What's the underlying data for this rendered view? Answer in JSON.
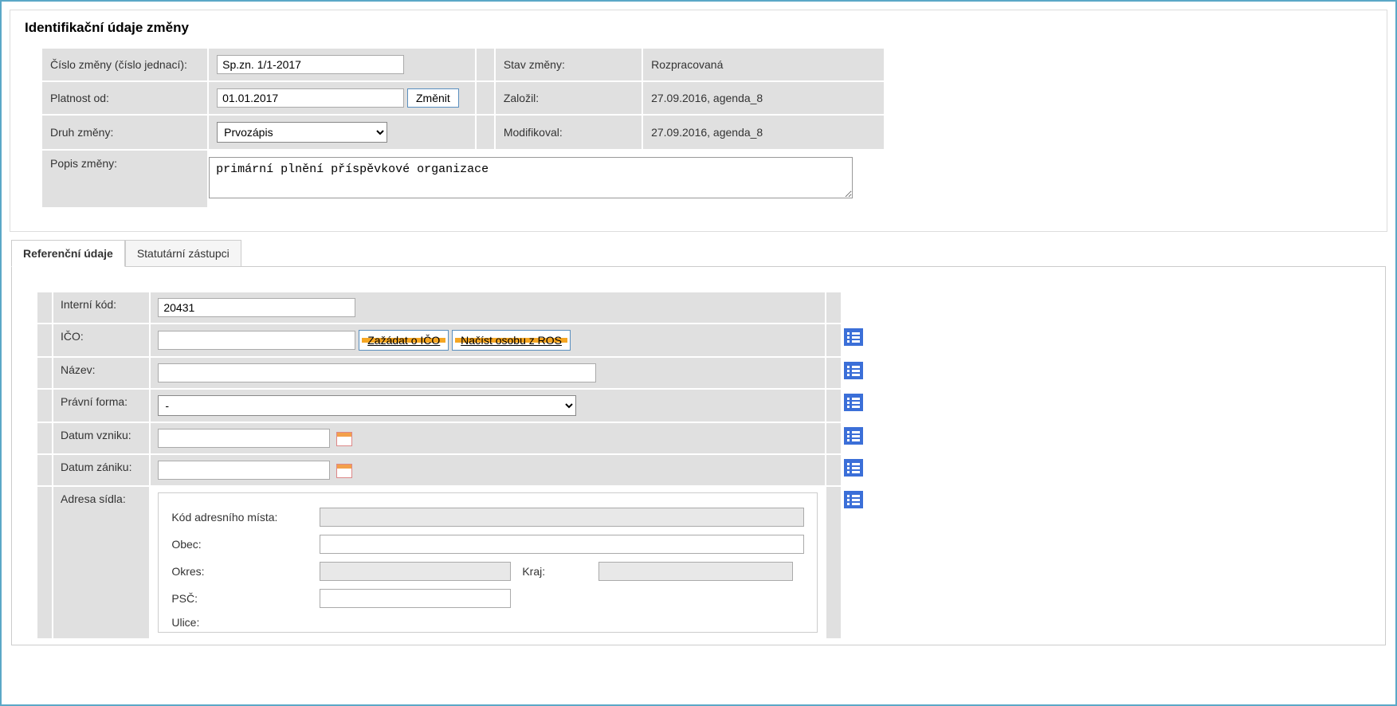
{
  "ident": {
    "title": "Identifikační údaje změny",
    "cislo_zmeny_label": "Číslo změny (číslo jednací):",
    "cislo_zmeny_value": "Sp.zn. 1/1-2017",
    "platnost_od_label": "Platnost od:",
    "platnost_od_value": "01.01.2017",
    "zmenit_btn": "Změnit",
    "druh_label": "Druh změny:",
    "druh_value": "Prvozápis",
    "popis_label": "Popis změny:",
    "popis_value": "primární plnění příspěvkové organizace",
    "stav_label": "Stav změny:",
    "stav_value": "Rozpracovaná",
    "zalozil_label": "Založil:",
    "zalozil_value": "27.09.2016, agenda_8",
    "modifikoval_label": "Modifikoval:",
    "modifikoval_value": "27.09.2016, agenda_8"
  },
  "tabs": {
    "ref": "Referenční údaje",
    "stat": "Statutární zástupci"
  },
  "ref": {
    "interni_kod_label": "Interní kód:",
    "interni_kod_value": "20431",
    "ico_label": "IČO:",
    "ico_value": "",
    "btn_zazadat": "Zažádat o IČO",
    "btn_nacist": "Načíst osobu z ROS",
    "nazev_label": "Název:",
    "nazev_value": "",
    "pravni_forma_label": "Právní forma:",
    "pravni_forma_value": "-",
    "datum_vzniku_label": "Datum vzniku:",
    "datum_vzniku_value": "",
    "datum_zaniku_label": "Datum zániku:",
    "datum_zaniku_value": "",
    "adresa_label": "Adresa sídla:"
  },
  "addr": {
    "kod_label": "Kód adresního místa:",
    "kod_value": "",
    "obec_label": "Obec:",
    "obec_value": "",
    "okres_label": "Okres:",
    "okres_value": "",
    "kraj_label": "Kraj:",
    "kraj_value": "",
    "psc_label": "PSČ:",
    "psc_value": "",
    "ulice_label": "Ulice:"
  }
}
